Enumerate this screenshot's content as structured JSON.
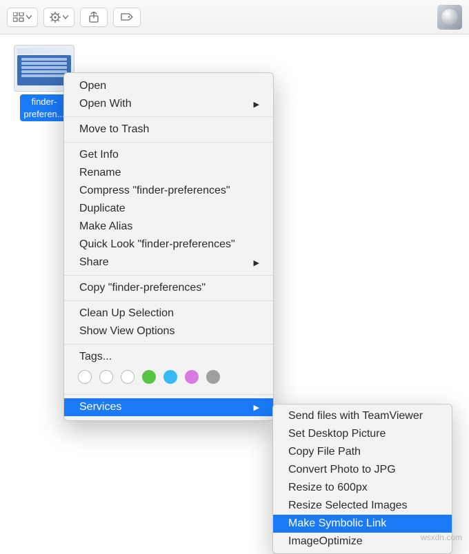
{
  "toolbar": {
    "view_icon": "grid-view",
    "action_icon": "gear",
    "share_icon": "share",
    "tags_icon": "tag"
  },
  "file": {
    "label_line1": "finder-",
    "label_line2": "preferen..."
  },
  "context_menu": {
    "open": "Open",
    "open_with": "Open With",
    "move_to_trash": "Move to Trash",
    "get_info": "Get Info",
    "rename": "Rename",
    "compress": "Compress \"finder-preferences\"",
    "duplicate": "Duplicate",
    "make_alias": "Make Alias",
    "quick_look": "Quick Look \"finder-preferences\"",
    "share": "Share",
    "copy": "Copy \"finder-preferences\"",
    "clean_up": "Clean Up Selection",
    "view_options": "Show View Options",
    "tags": "Tags...",
    "services": "Services"
  },
  "tag_colors": [
    "none",
    "none",
    "none",
    "#57c443",
    "#36b9f4",
    "#d97ae0",
    "#9f9f9f"
  ],
  "services_submenu": {
    "items": [
      "Send files with TeamViewer",
      "Set Desktop Picture",
      "Copy File Path",
      "Convert Photo to JPG",
      "Resize to 600px",
      "Resize Selected Images",
      "Make Symbolic Link",
      "ImageOptimize"
    ],
    "selected_index": 6
  },
  "watermark": "wsxdn.com"
}
